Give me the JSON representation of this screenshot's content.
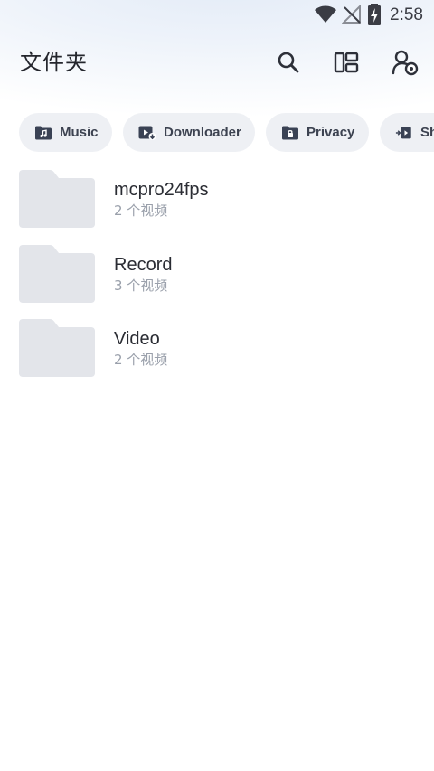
{
  "status_bar": {
    "time": "2:58",
    "icons": [
      "wifi-icon",
      "no-signal-icon",
      "battery-charging-icon"
    ]
  },
  "app_bar": {
    "title": "文件夹",
    "actions": [
      "search-icon",
      "layout-icon",
      "account-settings-icon"
    ]
  },
  "chips": [
    {
      "label": "Music",
      "icon": "music-folder-icon"
    },
    {
      "label": "Downloader",
      "icon": "download-video-icon"
    },
    {
      "label": "Privacy",
      "icon": "lock-folder-icon"
    },
    {
      "label": "Sh",
      "icon": "share-transfer-icon"
    }
  ],
  "folders": [
    {
      "name": "mcpro24fps",
      "count": "2 个视频"
    },
    {
      "name": "Record",
      "count": "3 个视频"
    },
    {
      "name": "Video",
      "count": "2 个视频"
    }
  ],
  "colors": {
    "chip_background": "#eef0f4",
    "folder_thumb": "#e3e5ea",
    "icon": "#3a4254",
    "subtitle": "#9aa0ab"
  }
}
